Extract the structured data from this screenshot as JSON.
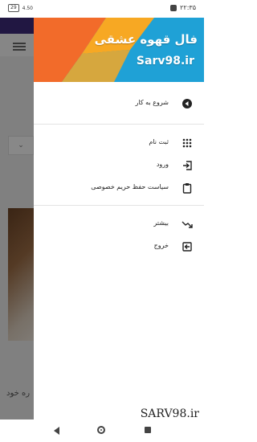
{
  "status_bar": {
    "battery": "29",
    "network_speed": "4.50",
    "time": "۲۲:۳۵"
  },
  "background": {
    "select_label": "",
    "partial_text": "ره خود"
  },
  "drawer": {
    "header": {
      "title": "فال قهوه عشقی",
      "subtitle": "Sarv98.ir",
      "colors": [
        "#f26b2a",
        "#f7a823",
        "#1fa1d6"
      ]
    },
    "items": [
      {
        "label": "شروع به کار",
        "icon": "play-circle-icon"
      },
      {
        "label": "ثبت نام",
        "icon": "dialpad-icon"
      },
      {
        "label": "ورود",
        "icon": "login-icon"
      },
      {
        "label": "سیاست حفظ حریم خصوصی",
        "icon": "clipboard-icon"
      },
      {
        "label": "بیشتر",
        "icon": "trending-down-icon"
      },
      {
        "label": "خروج",
        "icon": "exit-icon"
      }
    ]
  },
  "watermark": "SARV98.ir"
}
